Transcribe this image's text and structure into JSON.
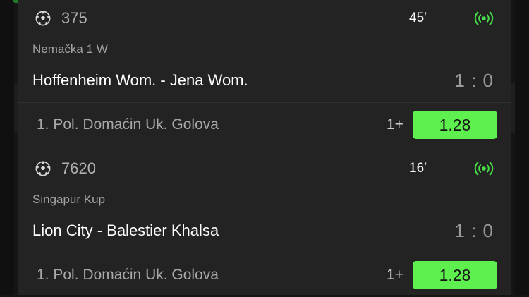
{
  "colors": {
    "accent": "#5ef04f",
    "live": "#47e04a",
    "divider": "#2e7d32"
  },
  "events": [
    {
      "event_id": "375",
      "minute": "45′",
      "league": "Nemačka 1 W",
      "teams": "Hoffenheim Wom. - Jena Wom.",
      "score": "1 : 0",
      "market": "1. Pol. Domaćin Uk. Golova",
      "bet_label": "1+",
      "odd": "1.28",
      "sport_icon": "soccer-ball-icon",
      "live_icon": "live-broadcast-icon"
    },
    {
      "event_id": "7620",
      "minute": "16′",
      "league": "Singapur Kup",
      "teams": "Lion City - Balestier Khalsa",
      "score": "1 : 0",
      "market": "1. Pol. Domaćin Uk. Golova",
      "bet_label": "1+",
      "odd": "1.28",
      "sport_icon": "soccer-ball-icon",
      "live_icon": "live-broadcast-icon"
    }
  ]
}
